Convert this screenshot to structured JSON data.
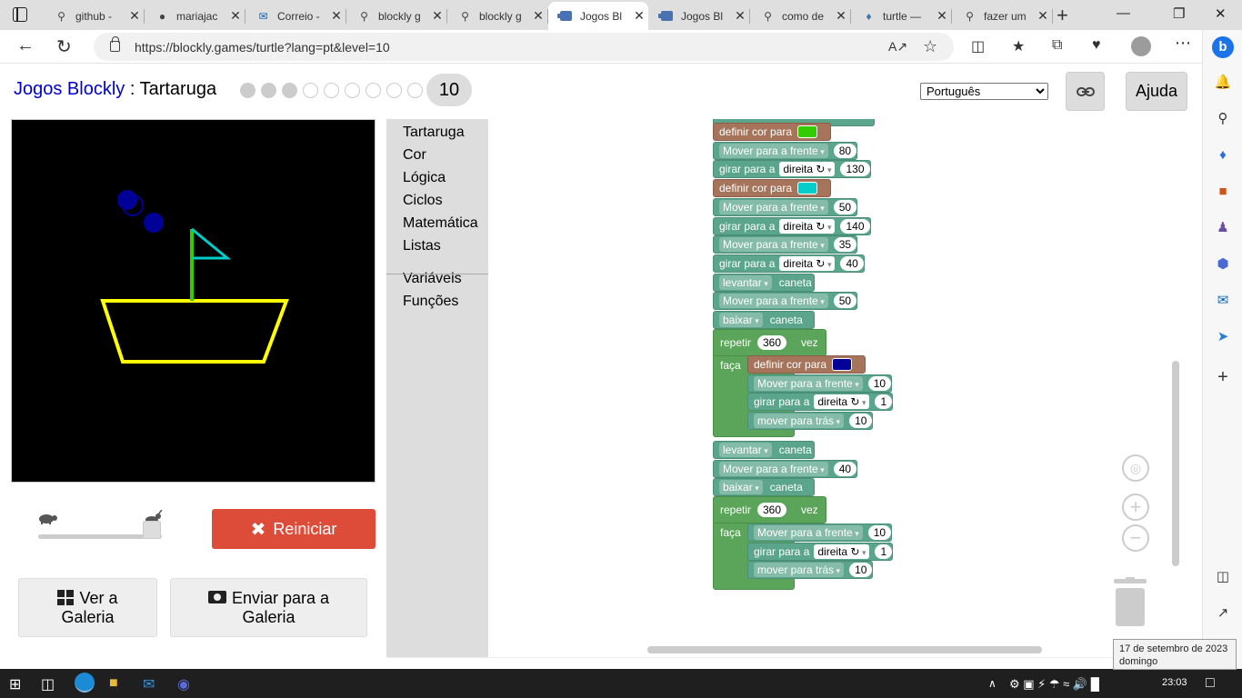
{
  "browser": {
    "tabs": [
      {
        "label": "github -",
        "icon": "search-icon"
      },
      {
        "label": "mariajac",
        "icon": "github-icon"
      },
      {
        "label": "Correio -",
        "icon": "outlook-icon"
      },
      {
        "label": "blockly g",
        "icon": "search-icon"
      },
      {
        "label": "blockly g",
        "icon": "search-icon"
      },
      {
        "label": "Jogos Bl",
        "icon": "blockly-icon",
        "active": true
      },
      {
        "label": "Jogos Bl",
        "icon": "blockly-icon"
      },
      {
        "label": "como de",
        "icon": "search-icon"
      },
      {
        "label": "turtle —",
        "icon": "python-icon"
      },
      {
        "label": "fazer um",
        "icon": "search-icon"
      }
    ],
    "url": "https://blockly.games/turtle?lang=pt&level=10"
  },
  "page": {
    "app_name": "Jogos Blockly",
    "separator": " : ",
    "game_name": "Tartaruga",
    "levels_total": 10,
    "levels_completed": 3,
    "current_level": "10",
    "language": "Português",
    "help_label": "Ajuda",
    "reset_label": "Reiniciar",
    "gallery_label_1": "Ver a",
    "gallery_label_2": "Galeria",
    "submit_label_1": "Enviar para a",
    "submit_label_2": "Galeria",
    "speed": 0.85
  },
  "toolbox": {
    "categories": [
      "Tartaruga",
      "Cor",
      "Lógica",
      "Ciclos",
      "Matemática",
      "Listas"
    ],
    "categories2": [
      "Variáveis",
      "Funções"
    ]
  },
  "blocks": [
    {
      "type": "color",
      "label": "definir cor para",
      "color": "#33cc00"
    },
    {
      "type": "motion",
      "label": "Mover para a frente",
      "value": "80"
    },
    {
      "type": "turn",
      "label": "girar para a",
      "dir": "direita ↻",
      "value": "130"
    },
    {
      "type": "color",
      "label": "definir cor para",
      "color": "#00cccc"
    },
    {
      "type": "motion",
      "label": "Mover para a frente",
      "value": "50"
    },
    {
      "type": "turn",
      "label": "girar para a",
      "dir": "direita ↻",
      "value": "140"
    },
    {
      "type": "motion",
      "label": "Mover para a frente",
      "value": "35"
    },
    {
      "type": "turn",
      "label": "girar para a",
      "dir": "direita ↻",
      "value": "40"
    },
    {
      "type": "pen",
      "dir": "levantar",
      "label": "caneta"
    },
    {
      "type": "motion",
      "label": "Mover para a frente",
      "value": "50"
    },
    {
      "type": "pen",
      "dir": "baixar",
      "label": "caneta"
    }
  ],
  "loop1": {
    "repeat": "repetir",
    "count": "360",
    "times": "vez",
    "do": "faça",
    "body": [
      {
        "type": "color",
        "label": "definir cor para",
        "color": "#000099"
      },
      {
        "type": "motion",
        "label": "Mover para a frente",
        "value": "10"
      },
      {
        "type": "turn",
        "label": "girar para a",
        "dir": "direita ↻",
        "value": "1"
      },
      {
        "type": "motion",
        "label": "mover para trás",
        "value": "10"
      }
    ]
  },
  "blocks2": [
    {
      "type": "pen",
      "dir": "levantar",
      "label": "caneta"
    },
    {
      "type": "motion",
      "label": "Mover para a frente",
      "value": "40"
    },
    {
      "type": "pen",
      "dir": "baixar",
      "label": "caneta"
    }
  ],
  "loop2": {
    "repeat": "repetir",
    "count": "360",
    "times": "vez",
    "do": "faça",
    "body": [
      {
        "type": "motion",
        "label": "Mover para a frente",
        "value": "10"
      },
      {
        "type": "turn",
        "label": "girar para a",
        "dir": "direita ↻",
        "value": "1"
      },
      {
        "type": "motion",
        "label": "mover para trás",
        "value": "10"
      }
    ]
  },
  "taskbar": {
    "time": "23:03",
    "tooltip_date": "17 de setembro de 2023",
    "tooltip_day": "domingo"
  }
}
